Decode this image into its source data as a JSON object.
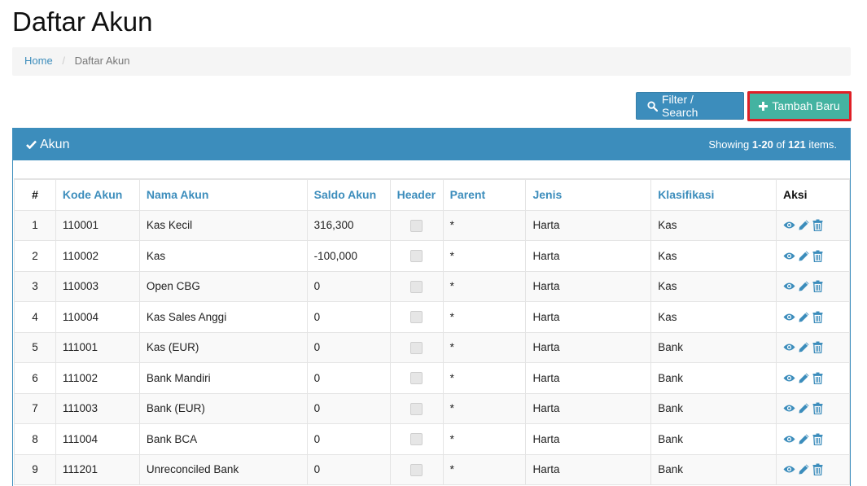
{
  "page": {
    "title": "Daftar Akun"
  },
  "breadcrumb": {
    "home": "Home",
    "separator": "/",
    "current": "Daftar Akun"
  },
  "toolbar": {
    "filter_label": "Filter / Search",
    "add_label": "Tambah Baru"
  },
  "panel": {
    "title": "Akun",
    "summary": {
      "prefix": "Showing",
      "range": "1-20",
      "of": "of",
      "total": "121",
      "suffix": "items."
    }
  },
  "table": {
    "columns": {
      "no": "#",
      "kode": "Kode Akun",
      "nama": "Nama Akun",
      "saldo": "Saldo Akun",
      "header": "Header",
      "parent": "Parent",
      "jenis": "Jenis",
      "klasifikasi": "Klasifikasi",
      "aksi": "Aksi"
    },
    "rows": [
      {
        "no": "1",
        "kode": "110001",
        "nama": "Kas Kecil",
        "saldo": "316,300",
        "header": false,
        "parent": "*",
        "jenis": "Harta",
        "klasifikasi": "Kas"
      },
      {
        "no": "2",
        "kode": "110002",
        "nama": "Kas",
        "saldo": "-100,000",
        "header": false,
        "parent": "*",
        "jenis": "Harta",
        "klasifikasi": "Kas"
      },
      {
        "no": "3",
        "kode": "110003",
        "nama": "Open CBG",
        "saldo": "0",
        "header": false,
        "parent": "*",
        "jenis": "Harta",
        "klasifikasi": "Kas"
      },
      {
        "no": "4",
        "kode": "110004",
        "nama": "Kas Sales Anggi",
        "saldo": "0",
        "header": false,
        "parent": "*",
        "jenis": "Harta",
        "klasifikasi": "Kas"
      },
      {
        "no": "5",
        "kode": "111001",
        "nama": "Kas (EUR)",
        "saldo": "0",
        "header": false,
        "parent": "*",
        "jenis": "Harta",
        "klasifikasi": "Bank"
      },
      {
        "no": "6",
        "kode": "111002",
        "nama": "Bank Mandiri",
        "saldo": "0",
        "header": false,
        "parent": "*",
        "jenis": "Harta",
        "klasifikasi": "Bank"
      },
      {
        "no": "7",
        "kode": "111003",
        "nama": "Bank (EUR)",
        "saldo": "0",
        "header": false,
        "parent": "*",
        "jenis": "Harta",
        "klasifikasi": "Bank"
      },
      {
        "no": "8",
        "kode": "111004",
        "nama": "Bank BCA",
        "saldo": "0",
        "header": false,
        "parent": "*",
        "jenis": "Harta",
        "klasifikasi": "Bank"
      },
      {
        "no": "9",
        "kode": "111201",
        "nama": "Unreconciled Bank",
        "saldo": "0",
        "header": false,
        "parent": "*",
        "jenis": "Harta",
        "klasifikasi": "Bank"
      }
    ]
  },
  "icons": {
    "view": "eye-icon",
    "edit": "pencil-icon",
    "delete": "trash-icon",
    "filter": "search-icon",
    "add": "plus-icon",
    "panel": "check-icon"
  },
  "colors": {
    "primary": "#3c8dbc",
    "success": "#44b3a1",
    "highlight": "#e01f26"
  }
}
